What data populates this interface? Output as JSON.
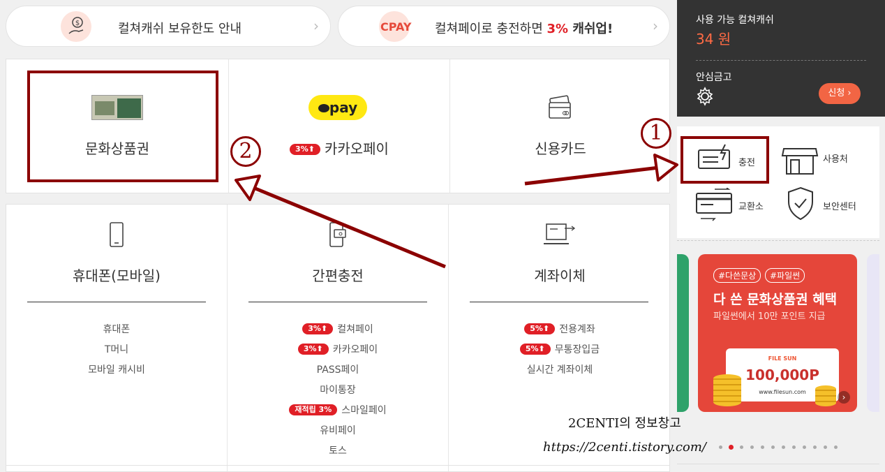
{
  "top": {
    "pill1_text": "컬쳐캐쉬 보유한도 안내",
    "pill2_cpay": "CPAY",
    "pill2_text_pre": "컬쳐페이로 충전하면 ",
    "pill2_text_pct": "3%",
    "pill2_text_post": " 캐쉬업!"
  },
  "methods_top": [
    {
      "label": "문화상품권"
    },
    {
      "label": "카카오페이",
      "badge": "3%⬆",
      "logo": "pay"
    },
    {
      "label": "신용카드"
    }
  ],
  "methods_bottom": [
    {
      "label": "휴대폰(모바일)",
      "items": [
        {
          "text": "휴대폰"
        },
        {
          "text": "T머니"
        },
        {
          "text": "모바일 캐시비"
        }
      ]
    },
    {
      "label": "간편충전",
      "items": [
        {
          "badge": "3%⬆",
          "text": "컬쳐페이"
        },
        {
          "badge": "3%⬆",
          "text": "카카오페이"
        },
        {
          "text": "PASS페이"
        },
        {
          "text": "마이통장"
        },
        {
          "badge": "재적립 3%",
          "text": "스마일페이"
        },
        {
          "text": "유비페이"
        },
        {
          "text": "토스"
        }
      ]
    },
    {
      "label": "계좌이체",
      "items": [
        {
          "badge": "5%⬆",
          "text": "전용계좌"
        },
        {
          "badge": "5%⬆",
          "text": "무통장입금"
        },
        {
          "text": "실시간 계좌이체"
        }
      ]
    }
  ],
  "account": {
    "cash_label": "사용 가능 컬쳐캐쉬",
    "cash_value": "34 원",
    "safe_label": "안심금고",
    "apply_button": "신청 ›"
  },
  "quick_menu": [
    "충전",
    "사용처",
    "교환소",
    "보안센터"
  ],
  "banner": {
    "tag1": "#다쓴문상",
    "tag2": "#파일썬",
    "title": "다 쓴 문화상품권 혜택",
    "subtitle": "파일썬에서 10만 포인트 지급",
    "brand": "FILE SUN",
    "amount": "100,000P",
    "url": "www.filesun.com"
  },
  "annotations": {
    "num1": "1",
    "num2": "2",
    "watermark_title": "2CENTI의 정보창고",
    "watermark_url": "https://2centi.tistory.com/"
  },
  "colors": {
    "accent": "#e01f26",
    "annot": "#8b0000",
    "kakao": "#ffe812",
    "orange": "#ff6b45"
  }
}
